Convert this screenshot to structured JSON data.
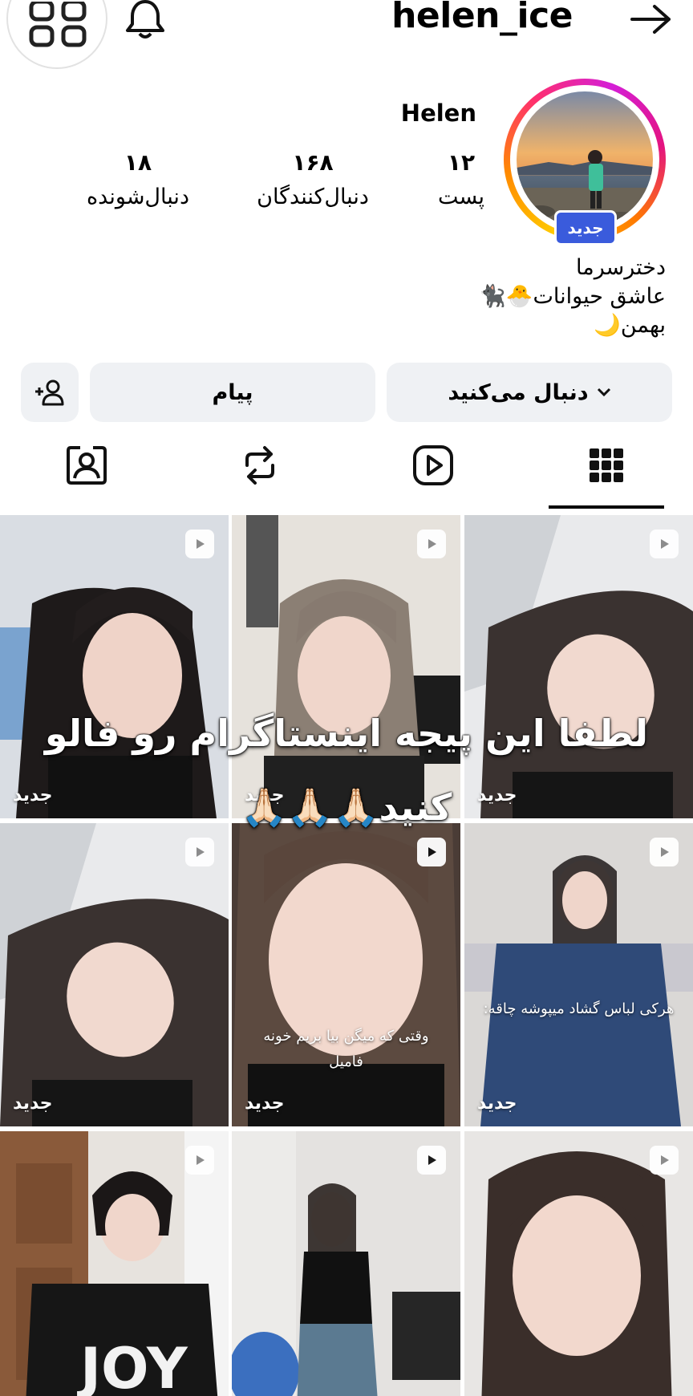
{
  "header": {
    "username": "helen_ice"
  },
  "profile": {
    "display_name": "Helen",
    "new_badge": "جدید",
    "stats": {
      "posts": {
        "value": "۱۲",
        "label": "پست"
      },
      "followers": {
        "value": "۱۶۸",
        "label": "دنبال‌کنندگان"
      },
      "following": {
        "value": "۱۸",
        "label": "دنبال‌شونده"
      }
    },
    "bio": [
      "دخترسرما",
      "عاشق حیوانات🐣🐈‍⬛",
      "بهمن🌙"
    ]
  },
  "actions": {
    "follow_label": "دنبال می‌کنید",
    "message_label": "پیام"
  },
  "tabs": [
    "grid-icon",
    "reels-icon",
    "reposts-icon",
    "tagged-icon"
  ],
  "posts": [
    {
      "badge": "جدید",
      "caption": ""
    },
    {
      "badge": "جدید",
      "caption": ""
    },
    {
      "badge": "جدید",
      "caption": ""
    },
    {
      "badge": "جدید",
      "caption": ""
    },
    {
      "badge": "جدید",
      "caption": "وقتی که میگن بیا بریم خونه فامیل"
    },
    {
      "badge": "جدید",
      "caption": "هرکی لباس گشاد میپوشه چاقه:"
    },
    {
      "badge": "",
      "caption": ""
    },
    {
      "badge": "",
      "caption": ""
    },
    {
      "badge": "",
      "caption": ""
    }
  ],
  "overlay": {
    "line1": "لطفا این پیجه اینستاگرام رو فالو",
    "line2": "کنید🙏🏻🙏🏻🙏🏻"
  },
  "colors": {
    "badge_blue": "#3a5bdc",
    "button_bg": "#eff1f4"
  }
}
